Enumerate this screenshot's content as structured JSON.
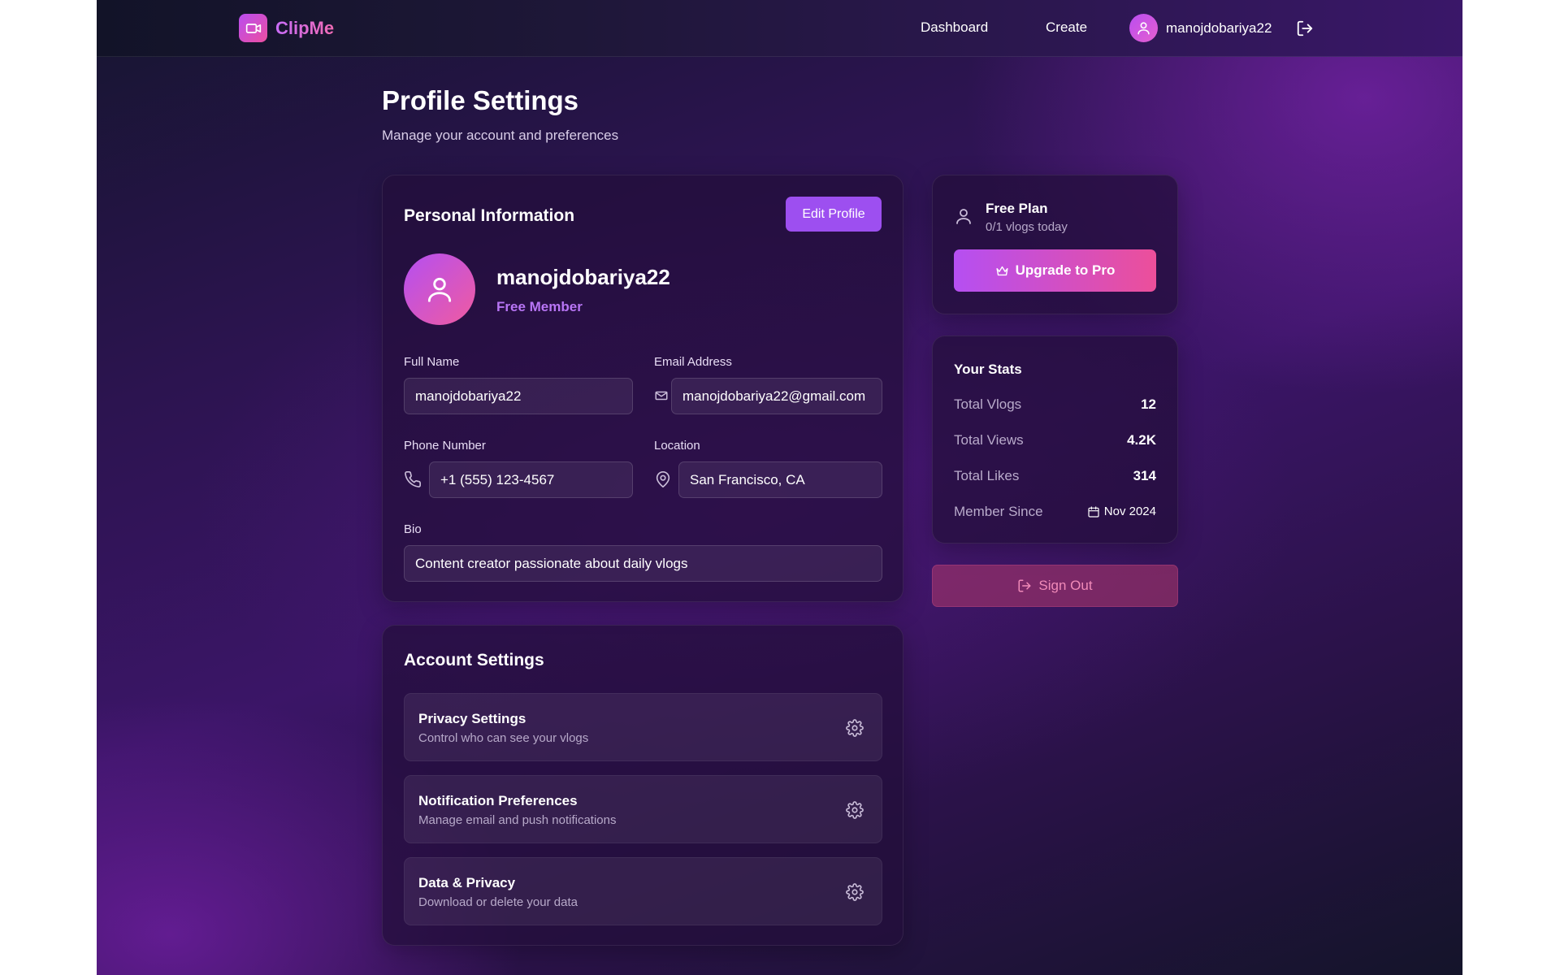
{
  "brand": {
    "name": "ClipMe"
  },
  "nav": {
    "links": [
      "Dashboard",
      "Create"
    ],
    "username": "manojdobariya22"
  },
  "header": {
    "title": "Profile Settings",
    "subtitle": "Manage your account and preferences"
  },
  "personal": {
    "title": "Personal Information",
    "edit_label": "Edit Profile",
    "name": "manojdobariya22",
    "role": "Free Member",
    "fields": {
      "full_name": {
        "label": "Full Name",
        "value": "manojdobariya22"
      },
      "email": {
        "label": "Email Address",
        "value": "manojdobariya22@gmail.com"
      },
      "phone": {
        "label": "Phone Number",
        "value": "+1 (555) 123-4567"
      },
      "location": {
        "label": "Location",
        "value": "San Francisco, CA"
      },
      "bio": {
        "label": "Bio",
        "value": "Content creator passionate about daily vlogs"
      }
    }
  },
  "account": {
    "title": "Account Settings",
    "items": [
      {
        "title": "Privacy Settings",
        "desc": "Control who can see your vlogs",
        "icon": "gear-icon"
      },
      {
        "title": "Notification Preferences",
        "desc": "Manage email and push notifications",
        "icon": "gear-icon"
      },
      {
        "title": "Data & Privacy",
        "desc": "Download or delete your data",
        "icon": "gear-icon"
      }
    ]
  },
  "plan": {
    "title": "Free Plan",
    "usage": "0/1 vlogs today",
    "upgrade_label": "Upgrade to Pro"
  },
  "stats": {
    "title": "Your Stats",
    "rows": [
      {
        "label": "Total Vlogs",
        "value": "12"
      },
      {
        "label": "Total Views",
        "value": "4.2K"
      },
      {
        "label": "Total Likes",
        "value": "314"
      },
      {
        "label": "Member Since",
        "value": "Nov 2024"
      }
    ]
  },
  "signout_label": "Sign Out",
  "colors": {
    "accent": "#9d4ff0",
    "gradient_start": "#b54ff2",
    "gradient_end": "#ec4f9a",
    "signout_text": "#f08ab8"
  }
}
